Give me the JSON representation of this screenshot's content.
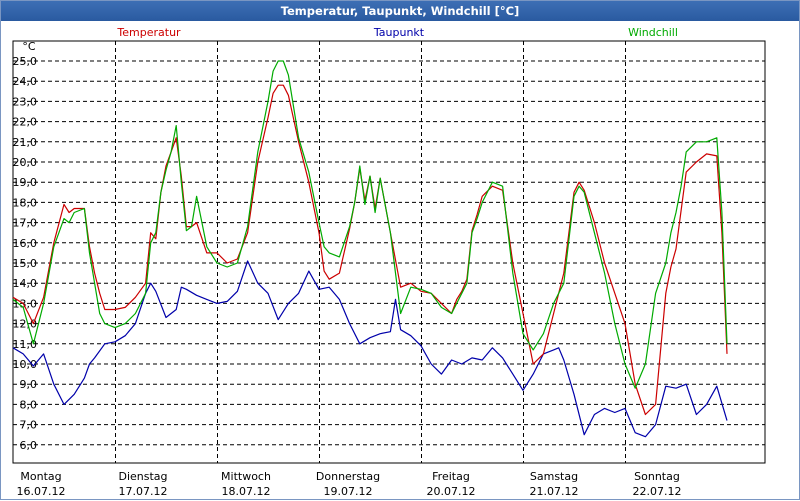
{
  "window": {
    "title": "Temperatur, Taupunkt, Windchill [°C]"
  },
  "chart_data": {
    "type": "line",
    "title": "Temperatur, Taupunkt, Windchill [°C]",
    "ylabel": "°C",
    "ylim": [
      5.0,
      26.0
    ],
    "yticks": [
      6.0,
      7.0,
      8.0,
      9.0,
      10.0,
      11.0,
      12.0,
      13.0,
      14.0,
      15.0,
      16.0,
      17.0,
      18.0,
      19.0,
      20.0,
      21.0,
      22.0,
      23.0,
      24.0,
      25.0
    ],
    "ytick_labels": [
      "6,0",
      "7,0",
      "8,0",
      "9,0",
      "10,0",
      "11,0",
      "12,0",
      "13,0",
      "14,0",
      "15,0",
      "16,0",
      "17,0",
      "18,0",
      "19,0",
      "20,0",
      "21,0",
      "22,0",
      "23,0",
      "24,0",
      "25,0"
    ],
    "xlim": [
      0,
      7
    ],
    "x_unit": "days from 16.07.12 00:00",
    "x_gridlines": [
      1,
      2,
      3,
      4,
      5,
      6
    ],
    "x_day_labels": [
      {
        "day": "Montag",
        "date": "16.07.12"
      },
      {
        "day": "Dienstag",
        "date": "17.07.12"
      },
      {
        "day": "Mittwoch",
        "date": "18.07.12"
      },
      {
        "day": "Donnerstag",
        "date": "19.07.12"
      },
      {
        "day": "Freitag",
        "date": "20.07.12"
      },
      {
        "day": "Samstag",
        "date": "21.07.12"
      },
      {
        "day": "Sonntag",
        "date": "22.07.12"
      }
    ],
    "grid": true,
    "grid_style": "dashed",
    "legend": "top, above plot",
    "series": [
      {
        "name": "Temperatur",
        "color": "#cc0000",
        "x": [
          0,
          0.1,
          0.2,
          0.3,
          0.4,
          0.5,
          0.55,
          0.6,
          0.7,
          0.75,
          0.8,
          0.85,
          0.9,
          1.0,
          1.1,
          1.2,
          1.3,
          1.35,
          1.4,
          1.45,
          1.5,
          1.55,
          1.6,
          1.65,
          1.7,
          1.75,
          1.8,
          1.9,
          2.0,
          2.1,
          2.2,
          2.3,
          2.4,
          2.5,
          2.55,
          2.6,
          2.65,
          2.7,
          2.8,
          2.9,
          3.0,
          3.05,
          3.1,
          3.2,
          3.3,
          3.35,
          3.4,
          3.45,
          3.5,
          3.55,
          3.6,
          3.7,
          3.8,
          3.9,
          4.0,
          4.1,
          4.2,
          4.3,
          4.35,
          4.4,
          4.45,
          4.5,
          4.55,
          4.6,
          4.7,
          4.8,
          4.9,
          5.0,
          5.1,
          5.2,
          5.3,
          5.4,
          5.5,
          5.55,
          5.6,
          5.7,
          5.8,
          5.9,
          6.0,
          6.1,
          6.2,
          6.3,
          6.4,
          6.45,
          6.5,
          6.55,
          6.6,
          6.7,
          6.8,
          6.9,
          6.95,
          7.0
        ],
        "y": [
          13.3,
          13.0,
          12.0,
          13.3,
          16.0,
          17.9,
          17.5,
          17.7,
          17.7,
          15.8,
          14.5,
          13.5,
          12.7,
          12.7,
          12.8,
          13.3,
          14.0,
          16.5,
          16.2,
          18.5,
          19.8,
          20.5,
          21.2,
          19.3,
          16.8,
          16.8,
          17.0,
          15.5,
          15.5,
          15.0,
          15.2,
          16.5,
          20.0,
          22.2,
          23.4,
          23.8,
          23.8,
          23.3,
          21.0,
          19.0,
          16.5,
          14.6,
          14.2,
          14.5,
          16.7,
          18.0,
          19.7,
          18.1,
          19.3,
          17.7,
          19.2,
          16.5,
          13.8,
          14.0,
          13.6,
          13.5,
          13.0,
          12.5,
          13.2,
          13.6,
          14.2,
          16.6,
          17.4,
          18.3,
          18.8,
          18.6,
          15.0,
          12.5,
          10.0,
          10.5,
          12.5,
          14.5,
          18.5,
          19.0,
          18.6,
          17.0,
          15.0,
          13.5,
          12.0,
          9.0,
          7.5,
          8.0,
          13.5,
          14.8,
          15.7,
          17.6,
          19.5,
          20.0,
          20.4,
          20.3,
          16.5,
          10.5
        ]
      },
      {
        "name": "Taupunkt",
        "color": "#0000aa",
        "x": [
          0,
          0.1,
          0.2,
          0.3,
          0.4,
          0.5,
          0.6,
          0.7,
          0.75,
          0.8,
          0.9,
          1.0,
          1.1,
          1.2,
          1.3,
          1.35,
          1.4,
          1.5,
          1.6,
          1.65,
          1.7,
          1.8,
          1.9,
          2.0,
          2.1,
          2.2,
          2.3,
          2.4,
          2.5,
          2.6,
          2.7,
          2.8,
          2.9,
          3.0,
          3.1,
          3.2,
          3.3,
          3.4,
          3.5,
          3.6,
          3.7,
          3.75,
          3.8,
          3.9,
          4.0,
          4.1,
          4.2,
          4.3,
          4.4,
          4.5,
          4.6,
          4.7,
          4.8,
          4.9,
          5.0,
          5.1,
          5.2,
          5.3,
          5.35,
          5.4,
          5.5,
          5.6,
          5.7,
          5.8,
          5.9,
          6.0,
          6.1,
          6.2,
          6.3,
          6.4,
          6.5,
          6.6,
          6.7,
          6.8,
          6.9,
          7.0
        ],
        "y": [
          10.8,
          10.5,
          9.9,
          10.5,
          9.0,
          8.0,
          8.5,
          9.3,
          10.0,
          10.3,
          11.0,
          11.1,
          11.4,
          12.0,
          13.5,
          14.0,
          13.6,
          12.3,
          12.7,
          13.8,
          13.7,
          13.4,
          13.2,
          13.0,
          13.1,
          13.6,
          15.1,
          14.0,
          13.5,
          12.2,
          13.0,
          13.5,
          14.6,
          13.7,
          13.8,
          13.2,
          12.0,
          11.0,
          11.3,
          11.5,
          11.6,
          13.2,
          11.7,
          11.4,
          10.9,
          10.0,
          9.5,
          10.2,
          10.0,
          10.3,
          10.2,
          10.8,
          10.3,
          9.5,
          8.7,
          9.5,
          10.5,
          10.7,
          10.8,
          10.2,
          8.5,
          6.5,
          7.5,
          7.8,
          7.6,
          7.8,
          6.6,
          6.4,
          7.0,
          8.9,
          8.8,
          9.0,
          7.5,
          8.0,
          8.9,
          7.2
        ]
      },
      {
        "name": "Windchill",
        "color": "#00aa00",
        "x": [
          0,
          0.1,
          0.2,
          0.3,
          0.4,
          0.5,
          0.55,
          0.6,
          0.7,
          0.75,
          0.8,
          0.85,
          0.9,
          1.0,
          1.1,
          1.2,
          1.3,
          1.35,
          1.4,
          1.45,
          1.5,
          1.55,
          1.6,
          1.65,
          1.7,
          1.75,
          1.8,
          1.9,
          2.0,
          2.1,
          2.2,
          2.3,
          2.4,
          2.5,
          2.55,
          2.6,
          2.65,
          2.7,
          2.8,
          2.9,
          3.0,
          3.05,
          3.1,
          3.2,
          3.3,
          3.35,
          3.4,
          3.45,
          3.5,
          3.55,
          3.6,
          3.7,
          3.8,
          3.9,
          4.0,
          4.1,
          4.2,
          4.3,
          4.35,
          4.4,
          4.45,
          4.5,
          4.55,
          4.6,
          4.7,
          4.8,
          4.9,
          5.0,
          5.1,
          5.2,
          5.3,
          5.4,
          5.5,
          5.55,
          5.6,
          5.7,
          5.8,
          5.9,
          6.0,
          6.1,
          6.2,
          6.3,
          6.4,
          6.45,
          6.5,
          6.55,
          6.6,
          6.7,
          6.8,
          6.9,
          6.95,
          7.0
        ],
        "y": [
          13.2,
          12.8,
          11.0,
          13.0,
          15.8,
          17.2,
          17.0,
          17.5,
          17.7,
          15.5,
          14.0,
          12.5,
          12.0,
          11.8,
          12.0,
          12.5,
          13.5,
          16.0,
          16.5,
          18.5,
          19.6,
          20.5,
          21.8,
          19.0,
          16.6,
          16.8,
          18.3,
          15.8,
          15.0,
          14.8,
          15.0,
          16.8,
          20.5,
          23.0,
          24.5,
          25.0,
          25.0,
          24.3,
          21.2,
          19.5,
          17.0,
          15.8,
          15.5,
          15.3,
          16.8,
          18.0,
          19.8,
          17.9,
          19.3,
          17.5,
          19.2,
          16.5,
          12.5,
          13.8,
          13.7,
          13.5,
          12.8,
          12.5,
          13.0,
          13.5,
          14.0,
          16.5,
          17.2,
          18.0,
          19.0,
          18.8,
          14.5,
          11.5,
          10.7,
          11.5,
          13.0,
          14.0,
          18.3,
          18.8,
          18.5,
          16.5,
          14.5,
          12.0,
          10.0,
          8.8,
          10.0,
          13.5,
          15.0,
          16.5,
          17.5,
          18.8,
          20.5,
          21.0,
          21.0,
          21.2,
          17.5,
          11.0
        ]
      }
    ]
  }
}
